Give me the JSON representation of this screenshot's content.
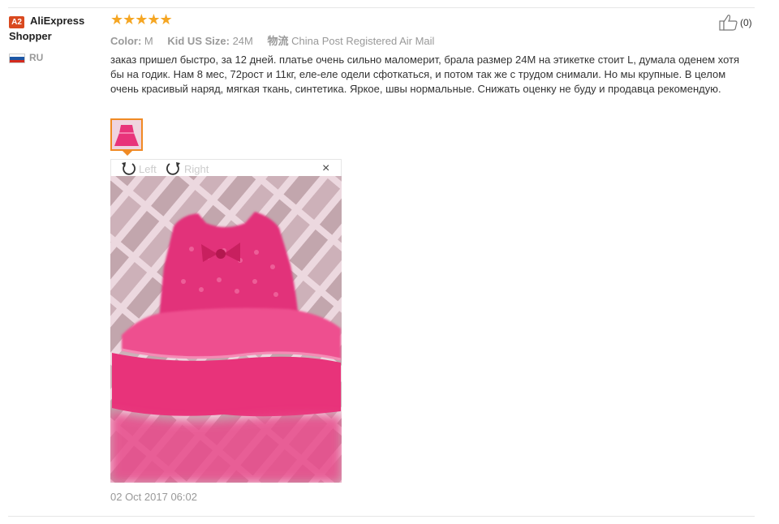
{
  "user": {
    "badge": "A2",
    "name_line1": "AliExpress",
    "name_line2": "Shopper",
    "country": "RU"
  },
  "rating": {
    "stars": 5,
    "max": 5,
    "glyphs": "★★★★★"
  },
  "attributes": [
    {
      "label": "Color:",
      "value": "M"
    },
    {
      "label": "Kid US Size:",
      "value": "24M"
    },
    {
      "label": "物流",
      "value": "China Post Registered Air Mail"
    }
  ],
  "helpful": {
    "count": "(0)"
  },
  "review_text": "заказ пришел быстро, за 12 дней. платье очень сильно маломерит, брала размер 24M на этикетке стоит L, думала оденем хотя бы на годик. Нам 8 мес, 72рост и 11кг, еле-еле одели сфоткаться, и потом так же с трудом снимали. Но мы крупные. В целом очень красивый наряд, мягкая ткань, синтетика. Яркое, швы нормальные. Снижать оценку не буду и продавца рекомендую.",
  "viewer": {
    "rotate_left": "Left",
    "rotate_right": "Right",
    "close": "×"
  },
  "date": "02 Oct 2017 06:02",
  "colors": {
    "star": "#f5a623",
    "badge": "#d9491f",
    "thumb_border": "#f08a24",
    "dress": "#e8337a"
  }
}
